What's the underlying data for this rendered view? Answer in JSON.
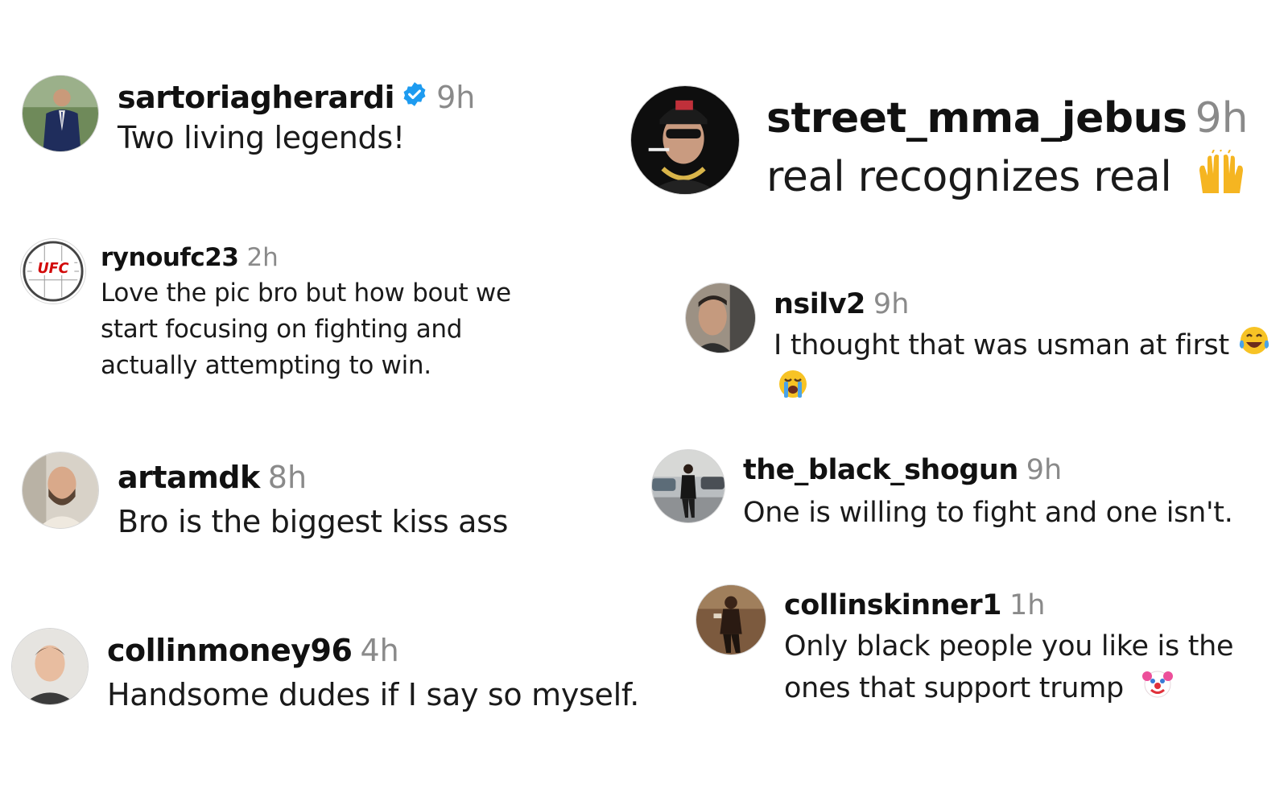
{
  "comments": [
    {
      "username": "sartoriagherardi",
      "verified": true,
      "time": "9h",
      "text": "Two living legends!",
      "avatar_icon": "avatar-man-in-suit"
    },
    {
      "username": "rynoufc23",
      "time": "2h",
      "text_lines": [
        "Love the pic bro but how bout we",
        "start focusing on fighting and",
        "actually attempting to win."
      ],
      "avatar_icon": "ufc-logo-avatar"
    },
    {
      "username": "artamdk",
      "time": "8h",
      "text": "Bro is the biggest kiss ass",
      "avatar_icon": "avatar-bearded-man"
    },
    {
      "username": "collinmoney96",
      "time": "4h",
      "text": "Handsome dudes if I say so myself.",
      "avatar_icon": "avatar-young-man"
    },
    {
      "username": "street_mma_jebus",
      "time": "9h",
      "text": "real recognizes real",
      "emoji": "raising-hands-emoji",
      "avatar_icon": "avatar-man-cap-sunglasses"
    },
    {
      "username": "nsilv2",
      "time": "9h",
      "text": "I thought that was usman at first",
      "emoji": "laughing-tears-emoji",
      "emoji2": "crying-emoji",
      "avatar_icon": "avatar-man-profile"
    },
    {
      "username": "the_black_shogun",
      "time": "9h",
      "text": "One is willing to fight and one isn't.",
      "avatar_icon": "avatar-street-figure"
    },
    {
      "username": "collinskinner1",
      "time": "1h",
      "text_lines": [
        "Only black people you like is the",
        "ones that support trump"
      ],
      "emoji": "clown-emoji",
      "avatar_icon": "avatar-mirror-selfie"
    }
  ],
  "colors": {
    "username": "#111111",
    "timestamp": "#8a8a8a",
    "verified_badge": "#1d9bf0",
    "text": "#1a1a1a"
  }
}
